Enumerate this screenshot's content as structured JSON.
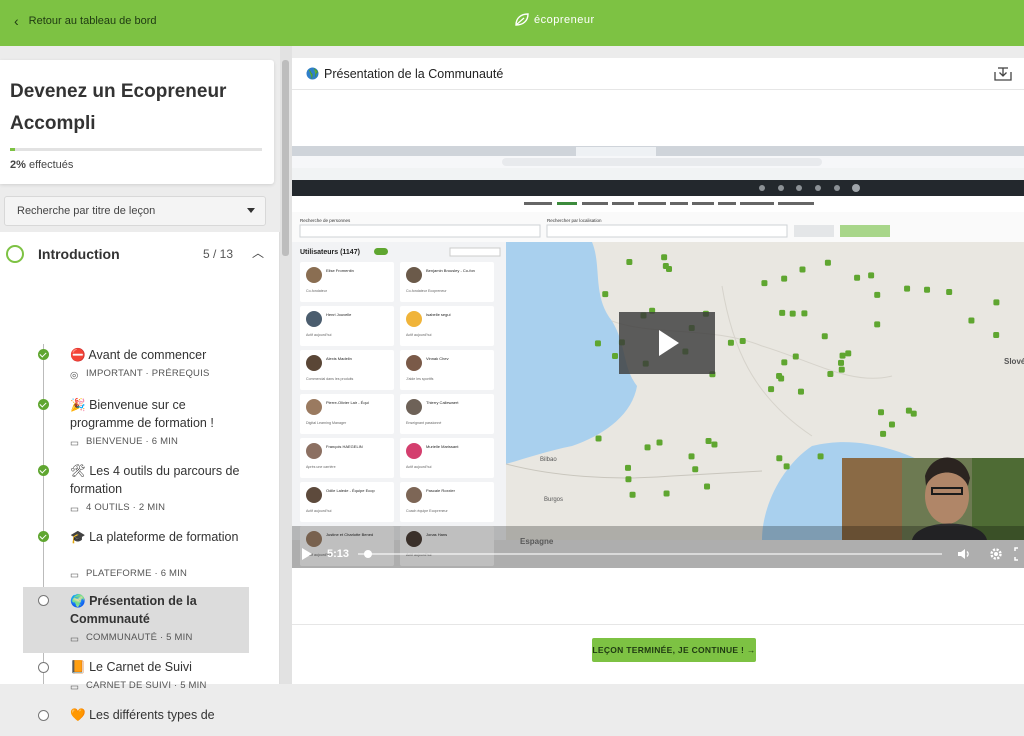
{
  "topbar": {
    "back_label": "Retour au tableau de bord",
    "brand": "écopreneur"
  },
  "course": {
    "title": "Devenez un Ecopreneur Accompli",
    "progress_percent": 2,
    "progress_value": "2%",
    "progress_suffix": "effectués"
  },
  "search": {
    "label": "Recherche par titre de leçon"
  },
  "section": {
    "title": "Introduction",
    "count": "5 / 13"
  },
  "lessons": [
    {
      "emoji": "⛔",
      "title": "Avant de commencer",
      "meta": "IMPORTANT · PRÉREQUIS",
      "status": "done"
    },
    {
      "emoji": "🎉",
      "title": "Bienvenue sur ce programme de formation !",
      "meta": "BIENVENUE · 6 MIN",
      "status": "done"
    },
    {
      "emoji": "🛠",
      "title": "Les 4 outils du parcours de formation",
      "meta": "4 OUTILS · 2 MIN",
      "status": "done"
    },
    {
      "emoji": "🎓",
      "title": "La plateforme de formation",
      "meta": "PLATEFORME · 6 MIN",
      "status": "done"
    },
    {
      "emoji": "🌍",
      "title": "Présentation de la Communauté",
      "meta": "COMMUNAUTÉ · 5 MIN",
      "status": "current"
    },
    {
      "emoji": "📙",
      "title": "Le Carnet de Suivi",
      "meta": "CARNET DE SUIVI · 5 MIN",
      "status": "todo"
    },
    {
      "emoji": "🧡",
      "title": "Les différents types de",
      "meta": "",
      "status": "todo"
    }
  ],
  "main": {
    "title": "Présentation de la Communauté",
    "video_time": "5:13",
    "video_progress": 0.01,
    "cta": "LEÇON TERMINÉE, JE CONTINUE ! →"
  },
  "video_frame": {
    "users_label": "Utilisateurs (1147)",
    "search_people": "Recherche de personnes",
    "search_location": "Rechercher par localisation",
    "map_cities": [
      "Bilbao",
      "Burgos",
      "Espagne",
      "Slové"
    ],
    "people": [
      {
        "name": "Elise Fromentin",
        "line": "Co-fondateur"
      },
      {
        "name": "Benjamin Brousley - Co-fondateur Ecopreneur",
        "line": "Co-fondateur Ecopreneur"
      },
      {
        "name": "Henri Jouvelle",
        "line": "Actif aujourd'hui"
      },
      {
        "name": "Isabelle segui",
        "line": "Actif aujourd'hui"
      },
      {
        "name": "Alexis Madelin",
        "line": "Commercial dans les produits"
      },
      {
        "name": "Vinnak Chev",
        "line": "J'aide les sportifs"
      },
      {
        "name": "Pierre-Olivier Lair - Équipe Ecopreneur",
        "line": "Digital Learning Manager"
      },
      {
        "name": "Thierry Callewaert",
        "line": "Enseignant passionné"
      },
      {
        "name": "François HAEGELIN",
        "line": "Après une carrière"
      },
      {
        "name": "Murielle Marissant",
        "line": "Actif aujourd'hui"
      },
      {
        "name": "Odile Lalede - Équipe Ecopreneur",
        "line": "Actif aujourd'hui"
      },
      {
        "name": "Pascale Roxxler",
        "line": "Coach équipe Ecopreneur"
      },
      {
        "name": "Justine et Charlotte Benedetti et Ripert",
        "line": "Actif aujourd'hui"
      },
      {
        "name": "Jonas Hans",
        "line": "Actif aujourd'hui"
      }
    ]
  },
  "colors": {
    "brand_green": "#7dc243",
    "done_green": "#5fa630"
  }
}
